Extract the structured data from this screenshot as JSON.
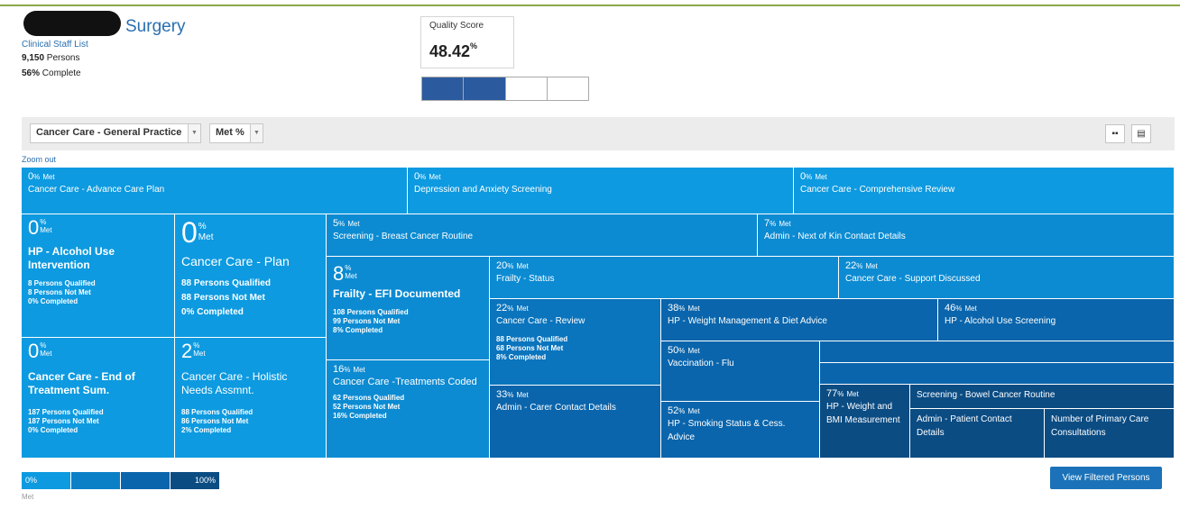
{
  "header": {
    "title": "Surgery",
    "staff_link": "Clinical Staff List",
    "persons_count": "9,150",
    "persons_label": " Persons",
    "complete_pct": "56%",
    "complete_label": " Complete"
  },
  "quality_score": {
    "label": "Quality Score",
    "value": "48.42",
    "unit": "%",
    "bar_segments_total": 4,
    "bar_segments_filled": 2,
    "fill_color": "#2b5a9e"
  },
  "filters": {
    "category": "Cancer Care - General Practice",
    "metric": "Met %"
  },
  "view_icons": [
    "grid-view-icon",
    "list-view-icon"
  ],
  "zoom_out": "Zoom out",
  "stat_labels": {
    "qualified": " Persons Qualified",
    "not_met": " Persons Not Met",
    "completed": " Completed",
    "met": "Met",
    "pct": "%"
  },
  "tiles": [
    {
      "pct": "0",
      "name": "Cancer Care - Advance Care Plan"
    },
    {
      "pct": "0",
      "name": "Depression and Anxiety Screening"
    },
    {
      "pct": "0",
      "name": "Cancer Care - Comprehensive Review"
    },
    {
      "pct": "0",
      "name": "HP - Alcohol Use Intervention",
      "qualified": "8",
      "not_met": "8",
      "completed": "0%"
    },
    {
      "pct": "0",
      "name": "Cancer Care - Plan",
      "qualified": "88",
      "not_met": "88",
      "completed": "0%"
    },
    {
      "pct": "5",
      "name": "Screening - Breast Cancer Routine"
    },
    {
      "pct": "7",
      "name": "Admin - Next of Kin Contact Details"
    },
    {
      "pct": "8",
      "name": "Frailty - EFI Documented",
      "qualified": "108",
      "not_met": "99",
      "completed": "8%"
    },
    {
      "pct": "20",
      "name": "Frailty - Status"
    },
    {
      "pct": "22",
      "name": "Cancer Care - Support Discussed"
    },
    {
      "pct": "22",
      "name": "Cancer Care - Review",
      "qualified": "88",
      "not_met": "68",
      "completed": "8%"
    },
    {
      "pct": "38",
      "name": "HP - Weight Management & Diet Advice"
    },
    {
      "pct": "46",
      "name": "HP - Alcohol Use Screening"
    },
    {
      "pct": "0",
      "name": "Cancer Care - End of Treatment Sum.",
      "qualified": "187",
      "not_met": "187",
      "completed": "0%"
    },
    {
      "pct": "2",
      "name": "Cancer Care - Holistic Needs Assmnt.",
      "qualified": "88",
      "not_met": "86",
      "completed": "2%"
    },
    {
      "pct": "16",
      "name": "Cancer Care -Treatments Coded",
      "qualified": "62",
      "not_met": "52",
      "completed": "16%"
    },
    {
      "pct": "33",
      "name": "Admin - Carer Contact Details"
    },
    {
      "pct": "50",
      "name": "Vaccination - Flu"
    },
    {
      "pct": "52",
      "name": "HP - Smoking Status & Cess. Advice"
    },
    {
      "pct": "77",
      "name": "HP - Weight and BMI Measurement"
    },
    {
      "name": "Screening - Bowel Cancer Routine"
    },
    {
      "name": "Admin - Patient Contact Details"
    },
    {
      "name": "Number of Primary Care Consultations"
    }
  ],
  "legend": {
    "min": "0%",
    "max": "100%",
    "label": "Met",
    "colors": [
      "#0d9ae0",
      "#0b80c7",
      "#0a65ac",
      "#0b4c83"
    ]
  },
  "view_filtered_button": "View Filtered Persons"
}
